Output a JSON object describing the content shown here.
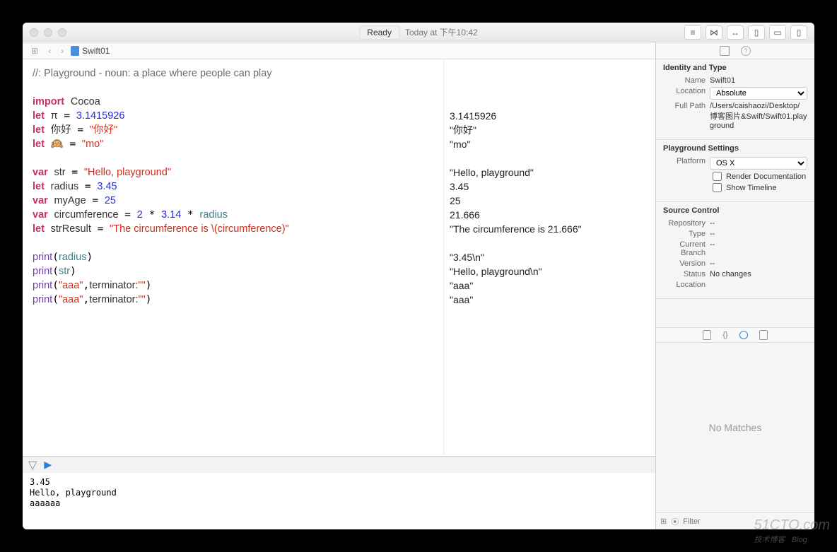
{
  "titlebar": {
    "status": "Ready",
    "time": "Today at 下午10:42"
  },
  "breadcrumb": {
    "file": "Swift01"
  },
  "code": {
    "comment": "//: Playground - noun: a place where people can play",
    "import": "import",
    "importMod": "Cocoa",
    "let": "let",
    "var": "var",
    "pi": "π",
    "piVal": "3.1415926",
    "hello": "你好",
    "helloStr": "\"你好\"",
    "monkey": "🙉",
    "monkeyStr": "\"mo\"",
    "strVar": "str",
    "strVal": "\"Hello, playground\"",
    "radius": "radius",
    "radiusVal": "3.45",
    "myAge": "myAge",
    "myAgeVal": "25",
    "circum": "circumference",
    "circumExpr1": "2",
    "circumExpr2": "3.14",
    "strResult": "strResult",
    "strResultVal": "\"The circumference is \\(circumference)\"",
    "print": "print",
    "aaaLit": "\"aaa\"",
    "term": "terminator:",
    "empty": "\"\""
  },
  "results": [
    "3.1415926",
    "\"你好\"",
    "\"mo\"",
    "",
    "\"Hello, playground\"",
    "3.45",
    "25",
    "21.666",
    "\"The circumference is 21.666\"",
    "",
    "\"3.45\\n\"",
    "\"Hello, playground\\n\"",
    "\"aaa\"",
    "\"aaa\""
  ],
  "console": "3.45\nHello, playground\naaaaaa",
  "inspector": {
    "identity": {
      "title": "Identity and Type",
      "nameLbl": "Name",
      "name": "Swift01",
      "locLbl": "Location",
      "loc": "Absolute",
      "pathLbl": "Full Path",
      "path": "/Users/caishaozi/Desktop/博客图片&Swift/Swift01.playground"
    },
    "settings": {
      "title": "Playground Settings",
      "platLbl": "Platform",
      "plat": "OS X",
      "renderDoc": "Render Documentation",
      "timeline": "Show Timeline"
    },
    "sc": {
      "title": "Source Control",
      "repoLbl": "Repository",
      "repo": "--",
      "typeLbl": "Type",
      "type": "--",
      "branchLbl": "Current Branch",
      "branch": "--",
      "verLbl": "Version",
      "ver": "--",
      "statusLbl": "Status",
      "status": "No changes",
      "locLbl": "Location",
      "loc": ""
    },
    "nomatches": "No Matches",
    "filterPh": "Filter"
  },
  "watermark": {
    "main": "51CTO.com",
    "sub": "技术博客",
    "blog": "Blog"
  }
}
